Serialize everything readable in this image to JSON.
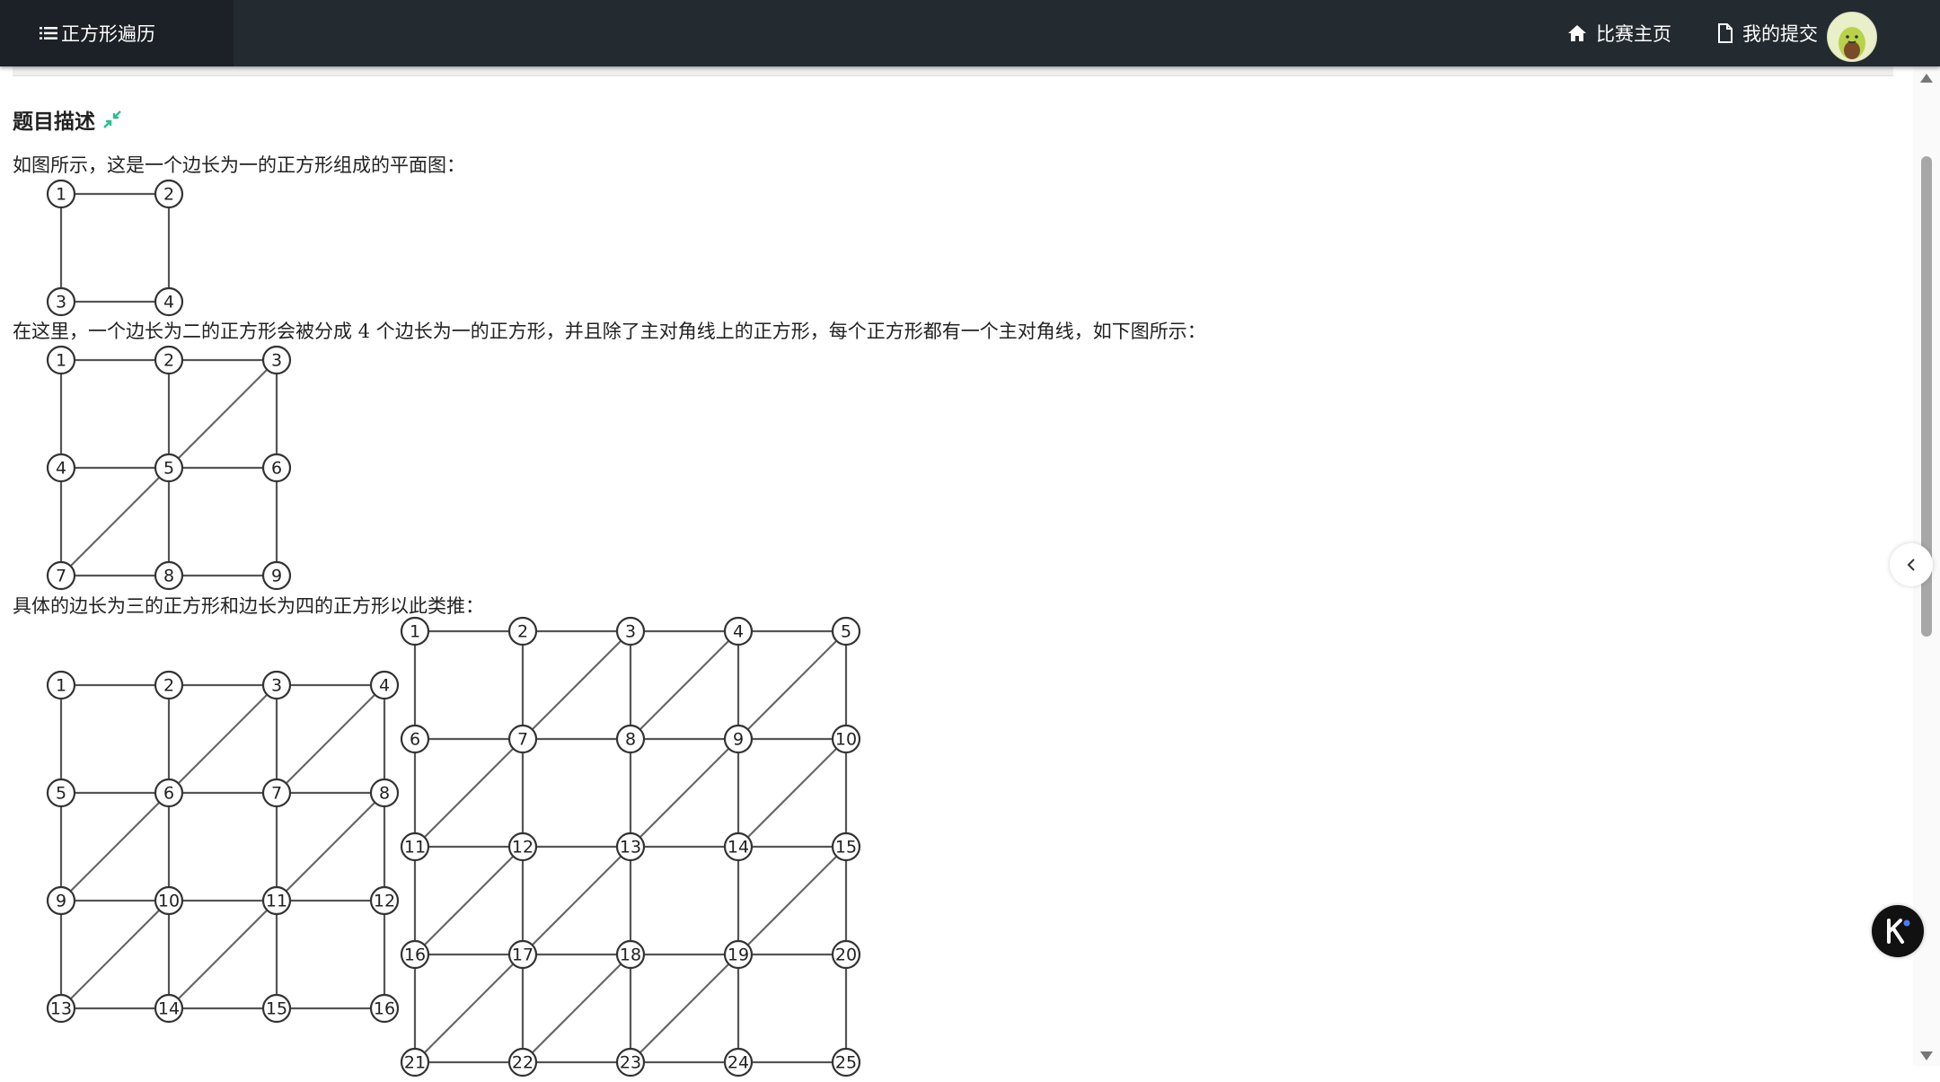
{
  "header": {
    "brand_title": "正方形遍历",
    "nav": [
      {
        "label": "比赛主页",
        "icon": "home-icon"
      },
      {
        "label": "我的提交",
        "icon": "file-icon"
      }
    ],
    "avatar": "user-avatar"
  },
  "problem": {
    "heading": "题目描述",
    "heading_icon": "collapse-arrows-icon",
    "paragraphs": [
      "如图所示，这是一个边长为一的正方形组成的平面图：",
      "在这里，一个边长为二的正方形会被分成 4 个边长为一的正方形，并且除了主对角线上的正方形，每个正方形都有一个主对角线，如下图所示：",
      "具体的边长为三的正方形和边长为四的正方形以此类推："
    ],
    "figures": [
      {
        "name": "figure-side-1",
        "side": 1,
        "nodes": [
          "1",
          "2",
          "3",
          "4"
        ],
        "diagonals": []
      },
      {
        "name": "figure-side-2",
        "side": 2,
        "nodes": [
          "1",
          "2",
          "3",
          "4",
          "5",
          "6",
          "7",
          "8",
          "9"
        ],
        "diagonals": [
          [
            0,
            1
          ],
          [
            1,
            0
          ]
        ]
      },
      {
        "name": "figure-side-3",
        "side": 3,
        "nodes": [
          "1",
          "2",
          "3",
          "4",
          "5",
          "6",
          "7",
          "8",
          "9",
          "10",
          "11",
          "12",
          "13",
          "14",
          "15",
          "16"
        ],
        "diagonals": [
          [
            0,
            1
          ],
          [
            0,
            2
          ],
          [
            1,
            0
          ],
          [
            1,
            2
          ],
          [
            2,
            0
          ],
          [
            2,
            1
          ]
        ]
      },
      {
        "name": "figure-side-4",
        "side": 4,
        "nodes": [
          "1",
          "2",
          "3",
          "4",
          "5",
          "6",
          "7",
          "8",
          "9",
          "10",
          "11",
          "12",
          "13",
          "14",
          "15",
          "16",
          "17",
          "18",
          "19",
          "20",
          "21",
          "22",
          "23",
          "24",
          "25"
        ],
        "diagonals": [
          [
            0,
            1
          ],
          [
            0,
            2
          ],
          [
            0,
            3
          ],
          [
            1,
            0
          ],
          [
            1,
            2
          ],
          [
            1,
            3
          ],
          [
            2,
            0
          ],
          [
            2,
            1
          ],
          [
            2,
            3
          ],
          [
            3,
            0
          ],
          [
            3,
            1
          ],
          [
            3,
            2
          ]
        ]
      }
    ]
  },
  "colors": {
    "topbar": "#232a30",
    "brand_bg": "#1b2126",
    "accent": "#2bbf8a"
  },
  "widgets": {
    "side_toggle_icon": "chevron-left-icon",
    "floating_icon": "k-logo-icon"
  }
}
